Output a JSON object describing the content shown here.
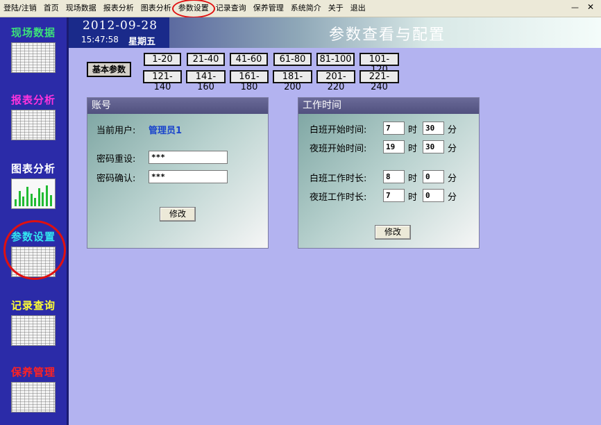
{
  "menu": {
    "items": [
      "登陆/注销",
      "首页",
      "现场数据",
      "报表分析",
      "图表分析",
      "参数设置",
      "记录查询",
      "保养管理",
      "系统简介",
      "关于",
      "退出"
    ],
    "min_glyph": "—",
    "close_glyph": "✕"
  },
  "sidebar": {
    "items": [
      {
        "label": "现场数据",
        "color": "#3ce07a"
      },
      {
        "label": "报表分析",
        "color": "#ff33dd"
      },
      {
        "label": "图表分析",
        "color": "#ffffff"
      },
      {
        "label": "参数设置",
        "color": "#33e6f0"
      },
      {
        "label": "记录查询",
        "color": "#ffff33"
      },
      {
        "label": "保养管理",
        "color": "#ff2222"
      }
    ]
  },
  "header": {
    "date": "2012-09-28",
    "time": "15:47:58",
    "weekday": "星期五",
    "title": "参数查看与配置"
  },
  "param": {
    "basic_label": "基本参数",
    "ranges_row1": [
      "1-20",
      "21-40",
      "41-60",
      "61-80",
      "81-100",
      "101-120"
    ],
    "ranges_row2": [
      "121-140",
      "141-160",
      "161-180",
      "181-200",
      "201-220",
      "221-240"
    ]
  },
  "account": {
    "title": "账号",
    "current_user_label": "当前用户:",
    "current_user": "管理员1",
    "pwd_reset_label": "密码重设:",
    "pwd_reset_value": "***",
    "pwd_confirm_label": "密码确认:",
    "pwd_confirm_value": "***",
    "modify_label": "修改"
  },
  "worktime": {
    "title": "工作时间",
    "hour_unit": "时",
    "min_unit": "分",
    "day_start_label": "白班开始时间:",
    "day_start_h": "7",
    "day_start_m": "30",
    "night_start_label": "夜班开始时间:",
    "night_start_h": "19",
    "night_start_m": "30",
    "day_dur_label": "白班工作时长:",
    "day_dur_h": "8",
    "day_dur_m": "0",
    "night_dur_label": "夜班工作时长:",
    "night_dur_h": "7",
    "night_dur_m": "0",
    "modify_label": "修改"
  },
  "colors": {
    "background": "#b3b3f0",
    "sidebar": "#2b2ba8",
    "highlight": "#e01010",
    "user_text": "#1a44cc"
  }
}
